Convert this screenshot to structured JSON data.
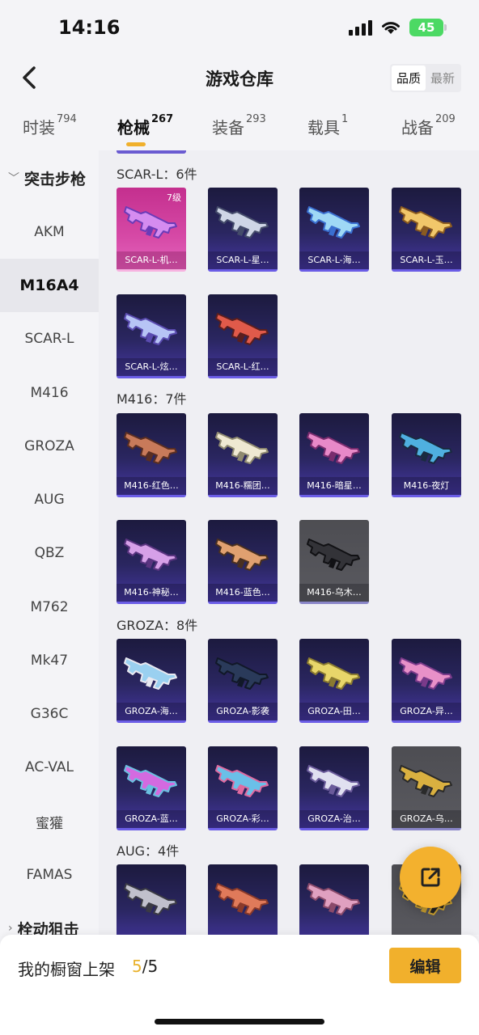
{
  "status": {
    "time": "14:16",
    "battery": "45"
  },
  "nav": {
    "title": "游戏仓库",
    "sort_quality": "品质",
    "sort_newest": "最新"
  },
  "top_tabs": [
    {
      "label": "时装",
      "count": "794"
    },
    {
      "label": "枪械",
      "count": "267"
    },
    {
      "label": "装备",
      "count": "293"
    },
    {
      "label": "载具",
      "count": "1"
    },
    {
      "label": "战备",
      "count": "209"
    }
  ],
  "sidebar": {
    "group_assault": "突击步枪",
    "items": [
      "AKM",
      "M16A4",
      "SCAR-L",
      "M416",
      "GROZA",
      "AUG",
      "QBZ",
      "M762",
      "Mk47",
      "G36C",
      "AC-VAL",
      "蜜獾",
      "FAMAS"
    ],
    "group_bolt": "栓动狙击"
  },
  "sections": [
    {
      "title": "SCAR-L：6件",
      "items": [
        {
          "label": "SCAR-L-机…",
          "level": "7级"
        },
        {
          "label": "SCAR-L-星…"
        },
        {
          "label": "SCAR-L-海…"
        },
        {
          "label": "SCAR-L-玉…"
        },
        {
          "label": "SCAR-L-炫…"
        },
        {
          "label": "SCAR-L-红…"
        }
      ]
    },
    {
      "title": "M416：7件",
      "items": [
        {
          "label": "M416-红色…"
        },
        {
          "label": "M416-糯团…"
        },
        {
          "label": "M416-暗星…"
        },
        {
          "label": "M416-夜灯"
        },
        {
          "label": "M416-神秘…"
        },
        {
          "label": "M416-蓝色…"
        },
        {
          "label": "M416-乌木…"
        }
      ]
    },
    {
      "title": "GROZA：8件",
      "items": [
        {
          "label": "GROZA-海…"
        },
        {
          "label": "GROZA-影袭"
        },
        {
          "label": "GROZA-田…"
        },
        {
          "label": "GROZA-异…"
        },
        {
          "label": "GROZA-蓝…"
        },
        {
          "label": "GROZA-彩…"
        },
        {
          "label": "GROZA-治…"
        },
        {
          "label": "GROZA-乌…"
        }
      ]
    },
    {
      "title": "AUG：4件",
      "items": []
    }
  ],
  "bottom": {
    "showcase_label": "我的橱窗上架",
    "current": "5",
    "total": "/5",
    "edit": "编辑"
  },
  "colors": {
    "accent": "#f1b02c",
    "card_purple": "#2a2660",
    "card_gold": "#d649a6",
    "scroll": "#6a5bd1"
  },
  "icons": [
    "back-arrow-icon",
    "signal-icon",
    "wifi-icon",
    "battery-icon",
    "share-icon",
    "chevron-down-icon",
    "chevron-right-icon"
  ]
}
